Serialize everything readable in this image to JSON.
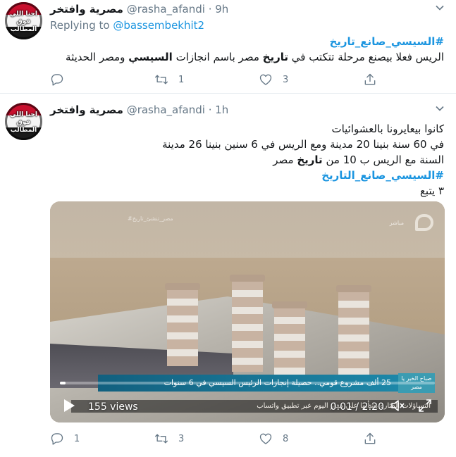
{
  "tweets": [
    {
      "display_name": "مصرية وافتخر",
      "handle": "@rasha_afandi",
      "separator": "·",
      "time": "9h",
      "reply_prefix": "Replying to",
      "reply_to": "@bassembekhit2",
      "hashtag": "#السيسي_صانع_تاريخ",
      "text_part1": "الريس فعلا بيصنع مرحلة تتكتب في",
      "text_bold1": "تاريخ",
      "text_part2": "مصر باسم انجازات",
      "text_bold2": "السيسي",
      "text_part3": "ومصر الحديثة",
      "counts": {
        "reply": "",
        "retweet": "1",
        "like": "3"
      }
    },
    {
      "display_name": "مصرية وافتخر",
      "handle": "@rasha_afandi",
      "separator": "·",
      "time": "1h",
      "line1": "كانوا بيعايرونا بالعشوائيات",
      "line2": "في 60 سنة بنينا 20 مدينة ومع الريس في 6 سنين بنينا 26 مدينة",
      "line3_part1": "السنة مع الريس ب 10 من",
      "line3_bold": "تاريخ",
      "line3_part2": "مصر",
      "hashtag": "#السيسي_صانع_التاريخ",
      "line5": "٣ يتبع",
      "video": {
        "views": "155 views",
        "duration": "0:01 / 2:20",
        "progress": 0.007,
        "lower_third": "25 ألف مشروع قومي.. حصيلة إنجازات الرئيس السيسي في 6 سنوات",
        "lower_logo": "صباح الخير يا مصر",
        "ticker": "التساؤلات المثارة بشأنها على مدار اليوم عبر تطبيق واتساب",
        "channel_bug_left": "#مصر_تنشئ_تاريخ",
        "channel_bug_live": "مباشر"
      },
      "counts": {
        "reply": "1",
        "retweet": "3",
        "like": "8"
      }
    }
  ],
  "avatar_text": "احنا اللي فوق المطالب",
  "colors": {
    "link": "#1b95e0",
    "muted": "#657786",
    "text": "#14171a"
  }
}
